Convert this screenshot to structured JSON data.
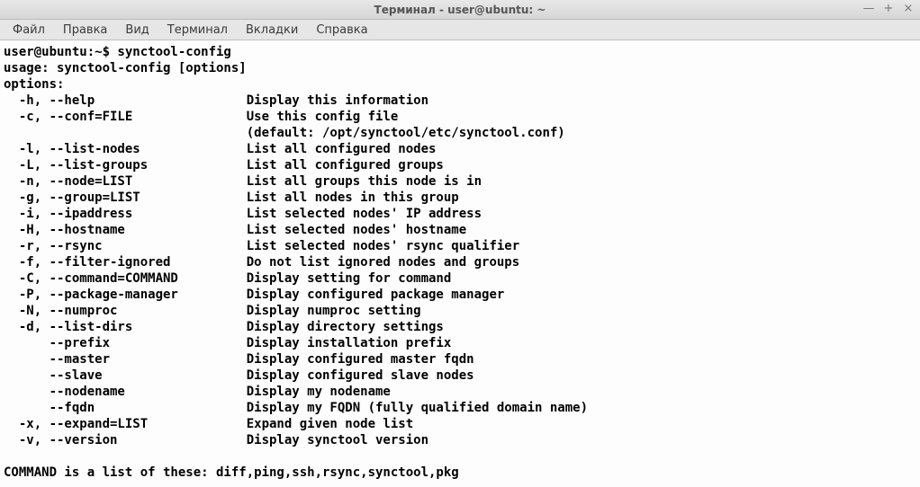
{
  "window": {
    "title": "Терминал - user@ubuntu: ~"
  },
  "menu": {
    "items": [
      "Файл",
      "Правка",
      "Вид",
      "Терминал",
      "Вкладки",
      "Справка"
    ]
  },
  "terminal": {
    "prompt": "user@ubuntu:~$ ",
    "command": "synctool-config",
    "usage": "usage: synctool-config [options]",
    "options_header": "options:",
    "options": [
      {
        "flag": "-h, --help",
        "desc": "Display this information"
      },
      {
        "flag": "-c, --conf=FILE",
        "desc": "Use this config file"
      },
      {
        "flag": "",
        "desc": "(default: /opt/synctool/etc/synctool.conf)"
      },
      {
        "flag": "-l, --list-nodes",
        "desc": "List all configured nodes"
      },
      {
        "flag": "-L, --list-groups",
        "desc": "List all configured groups"
      },
      {
        "flag": "-n, --node=LIST",
        "desc": "List all groups this node is in"
      },
      {
        "flag": "-g, --group=LIST",
        "desc": "List all nodes in this group"
      },
      {
        "flag": "-i, --ipaddress",
        "desc": "List selected nodes' IP address"
      },
      {
        "flag": "-H, --hostname",
        "desc": "List selected nodes' hostname"
      },
      {
        "flag": "-r, --rsync",
        "desc": "List selected nodes' rsync qualifier"
      },
      {
        "flag": "-f, --filter-ignored",
        "desc": "Do not list ignored nodes and groups"
      },
      {
        "flag": "-C, --command=COMMAND",
        "desc": "Display setting for command"
      },
      {
        "flag": "-P, --package-manager",
        "desc": "Display configured package manager"
      },
      {
        "flag": "-N, --numproc",
        "desc": "Display numproc setting"
      },
      {
        "flag": "-d, --list-dirs",
        "desc": "Display directory settings"
      },
      {
        "flag": "    --prefix",
        "desc": "Display installation prefix"
      },
      {
        "flag": "    --master",
        "desc": "Display configured master fqdn"
      },
      {
        "flag": "    --slave",
        "desc": "Display configured slave nodes"
      },
      {
        "flag": "    --nodename",
        "desc": "Display my nodename"
      },
      {
        "flag": "    --fqdn",
        "desc": "Display my FQDN (fully qualified domain name)"
      },
      {
        "flag": "-x, --expand=LIST",
        "desc": "Expand given node list"
      },
      {
        "flag": "-v, --version",
        "desc": "Display synctool version"
      }
    ],
    "footer": "COMMAND is a list of these: diff,ping,ssh,rsync,synctool,pkg"
  }
}
